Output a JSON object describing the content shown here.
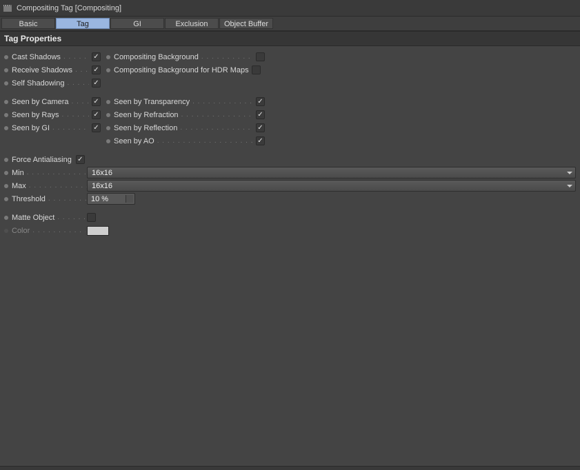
{
  "title": "Compositing Tag [Compositing]",
  "tabs": [
    "Basic",
    "Tag",
    "GI",
    "Exclusion",
    "Object Buffer"
  ],
  "active_tab": "Tag",
  "section": "Tag Properties",
  "props": {
    "cast_shadows": {
      "label": "Cast Shadows",
      "checked": true
    },
    "receive_shadows": {
      "label": "Receive Shadows",
      "checked": true
    },
    "self_shadowing": {
      "label": "Self Shadowing",
      "checked": true
    },
    "compositing_bg": {
      "label": "Compositing Background",
      "checked": false
    },
    "compositing_bg_hdr": {
      "label": "Compositing Background for HDR Maps",
      "checked": false
    },
    "seen_camera": {
      "label": "Seen by Camera",
      "checked": true
    },
    "seen_rays": {
      "label": "Seen by Rays",
      "checked": true
    },
    "seen_gi": {
      "label": "Seen by GI",
      "checked": true
    },
    "seen_transparency": {
      "label": "Seen by Transparency",
      "checked": true
    },
    "seen_refraction": {
      "label": "Seen by Refraction",
      "checked": true
    },
    "seen_reflection": {
      "label": "Seen by Reflection",
      "checked": true
    },
    "seen_ao": {
      "label": "Seen by AO",
      "checked": true
    },
    "force_aa": {
      "label": "Force Antialiasing",
      "checked": true
    },
    "min": {
      "label": "Min",
      "value": "16x16"
    },
    "max": {
      "label": "Max",
      "value": "16x16"
    },
    "threshold": {
      "label": "Threshold",
      "value": "10 %"
    },
    "matte_object": {
      "label": "Matte Object",
      "checked": false
    },
    "color": {
      "label": "Color"
    }
  }
}
